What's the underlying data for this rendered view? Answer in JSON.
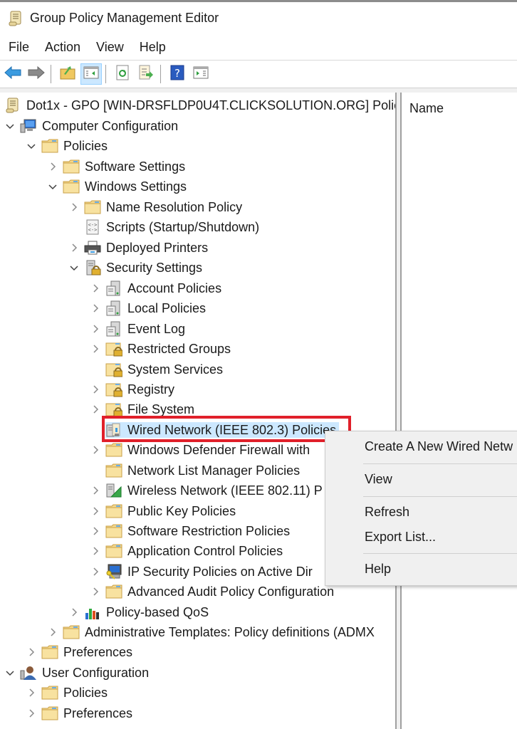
{
  "window": {
    "title": "Group Policy Management Editor",
    "app_icon": "scroll-document-icon"
  },
  "menubar": {
    "items": [
      "File",
      "Action",
      "View",
      "Help"
    ]
  },
  "toolbar": {
    "buttons": [
      {
        "name": "back",
        "icon": "back-arrow-icon",
        "enabled": true
      },
      {
        "name": "forward",
        "icon": "forward-arrow-icon",
        "enabled": false
      },
      {
        "name": "up-one-level",
        "icon": "folder-up-icon"
      },
      {
        "name": "show-hide-console-tree",
        "icon": "console-tree-icon",
        "active": true
      },
      {
        "name": "refresh",
        "icon": "refresh-icon"
      },
      {
        "name": "export-list",
        "icon": "export-list-icon"
      },
      {
        "name": "help",
        "icon": "help-icon"
      },
      {
        "name": "show-hide-action-pane",
        "icon": "action-pane-icon"
      }
    ]
  },
  "tree": {
    "root": "Dot1x - GPO [WIN-DRSFLDP0U4T.CLICKSOLUTION.ORG] Polic",
    "computer_configuration": "Computer Configuration",
    "cc_policies": "Policies",
    "software_settings": "Software Settings",
    "windows_settings": "Windows Settings",
    "name_resolution_policy": "Name Resolution Policy",
    "scripts": "Scripts (Startup/Shutdown)",
    "deployed_printers": "Deployed Printers",
    "security_settings": "Security Settings",
    "account_policies": "Account Policies",
    "local_policies": "Local Policies",
    "event_log": "Event Log",
    "restricted_groups": "Restricted Groups",
    "system_services": "System Services",
    "registry": "Registry",
    "file_system": "File System",
    "wired_network": "Wired Network (IEEE 802.3) Policies",
    "defender_firewall": "Windows Defender Firewall with",
    "network_list_manager": "Network List Manager Policies",
    "wireless_network": "Wireless Network (IEEE 802.11) P",
    "public_key": "Public Key Policies",
    "software_restriction": "Software Restriction Policies",
    "application_control": "Application Control Policies",
    "ip_security": "IP Security Policies on Active Dir",
    "advanced_audit": "Advanced Audit Policy Configuration",
    "policy_qos": "Policy-based QoS",
    "admin_templates": "Administrative Templates: Policy definitions (ADMX",
    "cc_preferences": "Preferences",
    "user_configuration": "User Configuration",
    "uc_policies": "Policies",
    "uc_preferences": "Preferences",
    "selected": "Wired Network (IEEE 802.3) Policies"
  },
  "list_pane": {
    "column_header": "Name"
  },
  "context_menu": {
    "items": [
      "Create A New Wired Network Policy",
      "View",
      "Refresh",
      "Export List...",
      "Help"
    ],
    "visible_first_item": "Create A New Wired Netw"
  },
  "colors": {
    "selection": "#cce8ff",
    "highlight_box": "#e0202a",
    "menu_background": "#f0f0f0"
  }
}
